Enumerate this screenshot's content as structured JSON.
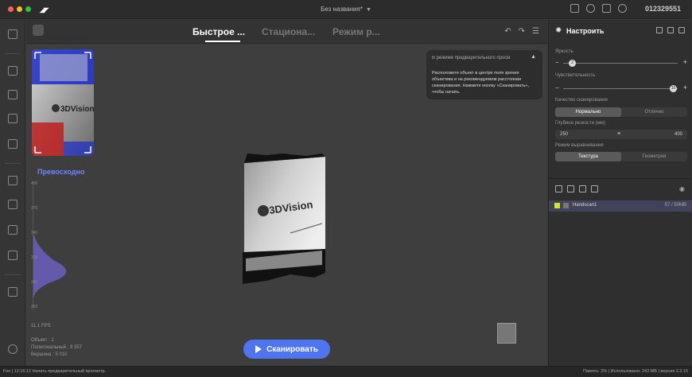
{
  "window": {
    "title": "Без названия*",
    "serial": "012329551"
  },
  "tabs": [
    {
      "label": "Быстрое ..."
    },
    {
      "label": "Стациона..."
    },
    {
      "label": "Режим р..."
    }
  ],
  "viewport": {
    "preview_label": "Превосходно",
    "scale_ticks": [
      "400",
      "370",
      "340",
      "310",
      "280",
      "250"
    ],
    "fps": "11.1 FPS",
    "stats": {
      "object": "Объект : 1",
      "polygons": "Полигональный : 9 357",
      "vertices": "Вершина : 5 010"
    },
    "info_box": {
      "title": "В режиме предварительного просм",
      "body": "Расположите объект в центре поля зрения объектива и на рекомендуемом расстоянии сканирования. Нажмите кнопку «Сканировать», чтобы начать."
    },
    "scan_button": "Сканировать",
    "object_logo": "3DVision"
  },
  "settings": {
    "title": "Настроить",
    "brightness_label": "Яркость",
    "brightness_value": "2",
    "sensitivity_label": "Чувствительность",
    "sensitivity_value": "10",
    "quality_label": "Качество сканирования",
    "quality_options": [
      "Нормально",
      "Отлично"
    ],
    "quality_selected": "Нормально",
    "depth_label": "Глубина резкости (мм)",
    "depth_min": "250",
    "depth_max": "400",
    "align_label": "Режим выравнивания",
    "align_options": [
      "Текстура",
      "Геометрия"
    ],
    "align_selected": "Текстура"
  },
  "scan_list": [
    {
      "name": "Handscan1",
      "size": "57 / 50MB"
    }
  ],
  "statusbar": {
    "left": "Fox  |  12:16:12 Начать предварительный просмотр.",
    "right": "Память: 2% | Использовано: 243 MB | версия 2.3.15"
  },
  "colors": {
    "accent": "#4f74ef",
    "preview_label": "#6f84ff",
    "selected_row": "#41435a",
    "item_check": "#d6e52a"
  }
}
